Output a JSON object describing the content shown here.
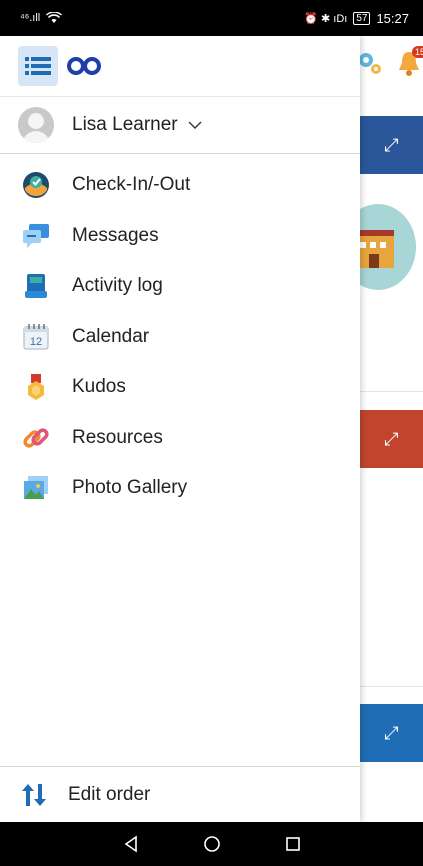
{
  "status_bar": {
    "left_signal": "⁴⁶.ıll",
    "wifi": "wifi",
    "right_icons": "⏰ ✱ ıDı",
    "battery": "57",
    "time": "15:27"
  },
  "header": {
    "notification_count": "15"
  },
  "user": {
    "name": "Lisa Learner"
  },
  "menu": [
    {
      "label": "Check-In/-Out",
      "icon": "checkin-icon"
    },
    {
      "label": "Messages",
      "icon": "messages-icon"
    },
    {
      "label": "Activity log",
      "icon": "activity-log-icon"
    },
    {
      "label": "Calendar",
      "icon": "calendar-icon"
    },
    {
      "label": "Kudos",
      "icon": "kudos-icon"
    },
    {
      "label": "Resources",
      "icon": "resources-icon"
    },
    {
      "label": "Photo Gallery",
      "icon": "photo-gallery-icon"
    }
  ],
  "calendar_day": "12",
  "bottom": {
    "label": "Edit order"
  },
  "colors": {
    "accent_blue": "#2b579a",
    "accent_red": "#c1452c",
    "logo_blue": "#1f3fa8"
  }
}
